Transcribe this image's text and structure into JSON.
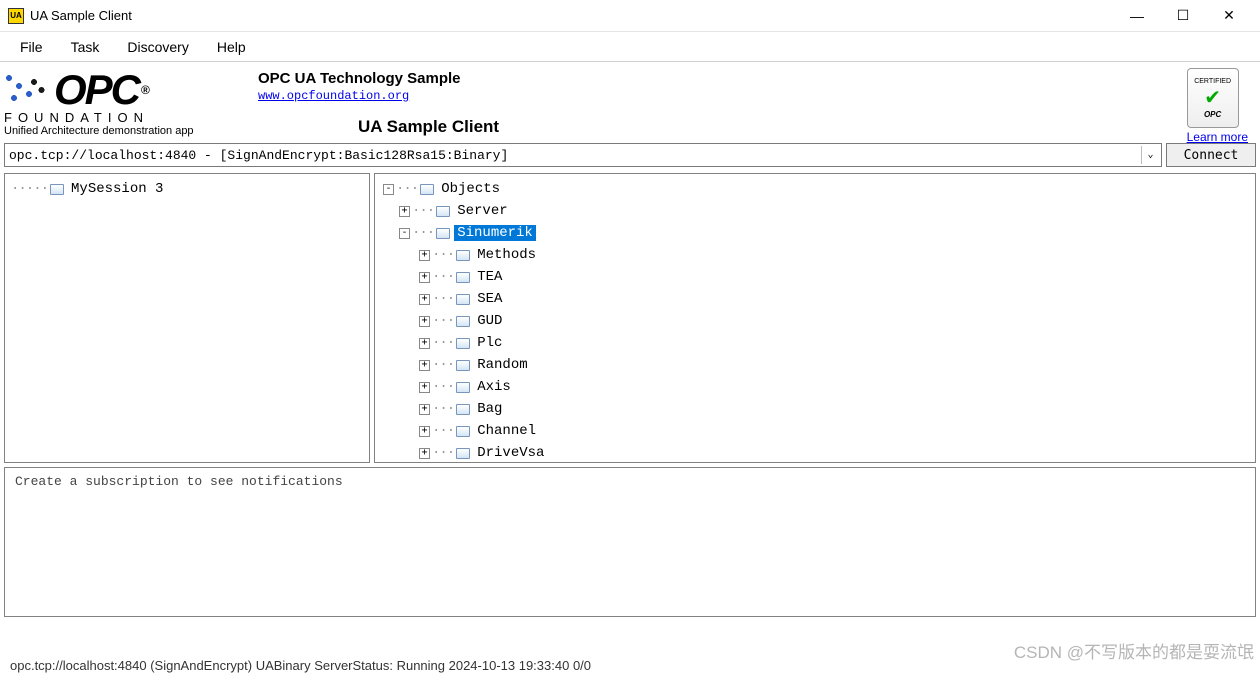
{
  "window": {
    "title": "UA Sample Client"
  },
  "menu": {
    "file": "File",
    "task": "Task",
    "discovery": "Discovery",
    "help": "Help"
  },
  "banner": {
    "logo_text": "OPC",
    "reg": "®",
    "foundation": "FOUNDATION",
    "tagline": "Unified Architecture demonstration app",
    "tech_title": "OPC UA Technology Sample",
    "link": "www.opcfoundation.org",
    "sample_client": "UA Sample Client",
    "cert_label": "CERTIFIED",
    "cert_opc": "OPC",
    "learn_more": "Learn more"
  },
  "connection": {
    "url": "opc.tcp://localhost:4840 - [SignAndEncrypt:Basic128Rsa15:Binary]",
    "connect_btn": "Connect"
  },
  "left_tree": {
    "root": "MySession 3"
  },
  "right_tree": {
    "root": "Objects",
    "server": "Server",
    "sinumerik": "Sinumerik",
    "children": {
      "methods": "Methods",
      "tea": "TEA",
      "sea": "SEA",
      "gud": "GUD",
      "plc": "Plc",
      "random": "Random",
      "axis": "Axis",
      "bag": "Bag",
      "channel": "Channel",
      "drivevsa": "DriveVsa"
    }
  },
  "notifications": {
    "placeholder": "Create a subscription to see notifications"
  },
  "status": {
    "text": "opc.tcp://localhost:4840 (SignAndEncrypt) UABinary  ServerStatus: Running 2024-10-13 19:33:40 0/0"
  },
  "watermark": "CSDN @不写版本的都是耍流氓"
}
